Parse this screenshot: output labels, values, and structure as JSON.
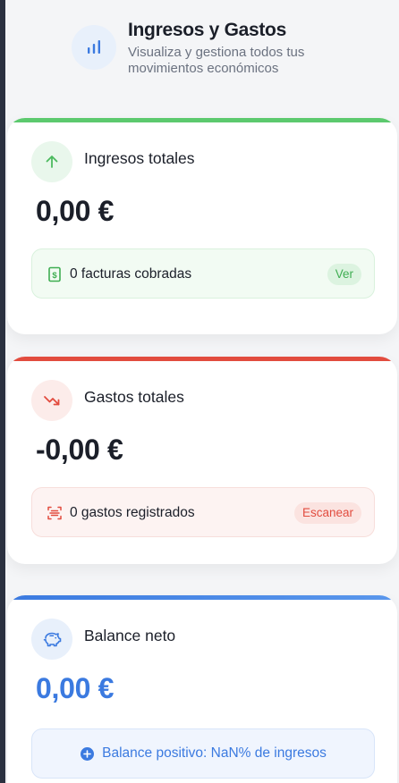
{
  "header": {
    "title": "Ingresos y Gastos",
    "subtitle": "Visualiza y gestiona todos tus movimientos económicos",
    "icon": "bar-chart-icon"
  },
  "income": {
    "title": "Ingresos totales",
    "amount": "0,00 €",
    "pill_text": "0 facturas cobradas",
    "button": "Ver",
    "accent": "#5cc96e",
    "icon": "arrow-up-icon"
  },
  "expenses": {
    "title": "Gastos totales",
    "amount": "-0,00 €",
    "pill_text": "0 gastos registrados",
    "button": "Escanear",
    "accent": "#e24c3f",
    "icon": "trend-down-icon"
  },
  "balance": {
    "title": "Balance neto",
    "amount": "0,00 €",
    "note": "Balance positivo: NaN% de ingresos",
    "accent": "#3b7ae0",
    "icon": "piggy-bank-icon"
  }
}
